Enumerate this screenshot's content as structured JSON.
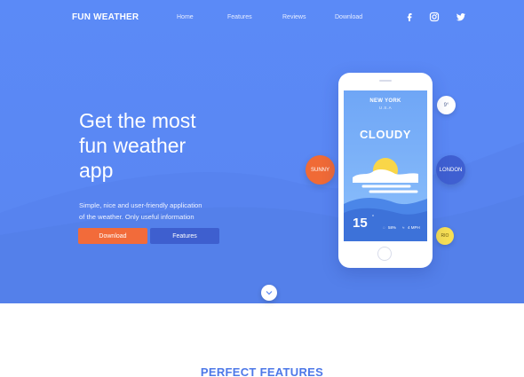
{
  "header": {
    "brand": "FUN WEATHER",
    "nav": [
      "Home",
      "Features",
      "Reviews",
      "Download"
    ],
    "social_icons": [
      "facebook-icon",
      "instagram-icon",
      "twitter-icon"
    ]
  },
  "hero": {
    "headline_lines": [
      "Get the most",
      "fun weather",
      "app"
    ],
    "subtitle_lines": [
      "Simple, nice and user-friendly application",
      "of the weather. Only useful information"
    ],
    "buttons": {
      "download": "Download",
      "features": "Features"
    }
  },
  "phone": {
    "city": "NEW YORK",
    "country": "U.S.A",
    "condition": "CLOUDY",
    "temperature": "15",
    "degree_mark": "°",
    "humidity": "58%",
    "wind": "4 MPH"
  },
  "bubbles": {
    "sunny": "SUNNY",
    "london": "LONDON",
    "nine": "9°",
    "rio": "RIO"
  },
  "section": {
    "title": "PERFECT FEATURES"
  },
  "colors": {
    "hero_blue": "#5a87f3",
    "accent_orange": "#f26b3a",
    "button_blue": "#3e5fcf",
    "bubble_yellow": "#f7df54"
  }
}
